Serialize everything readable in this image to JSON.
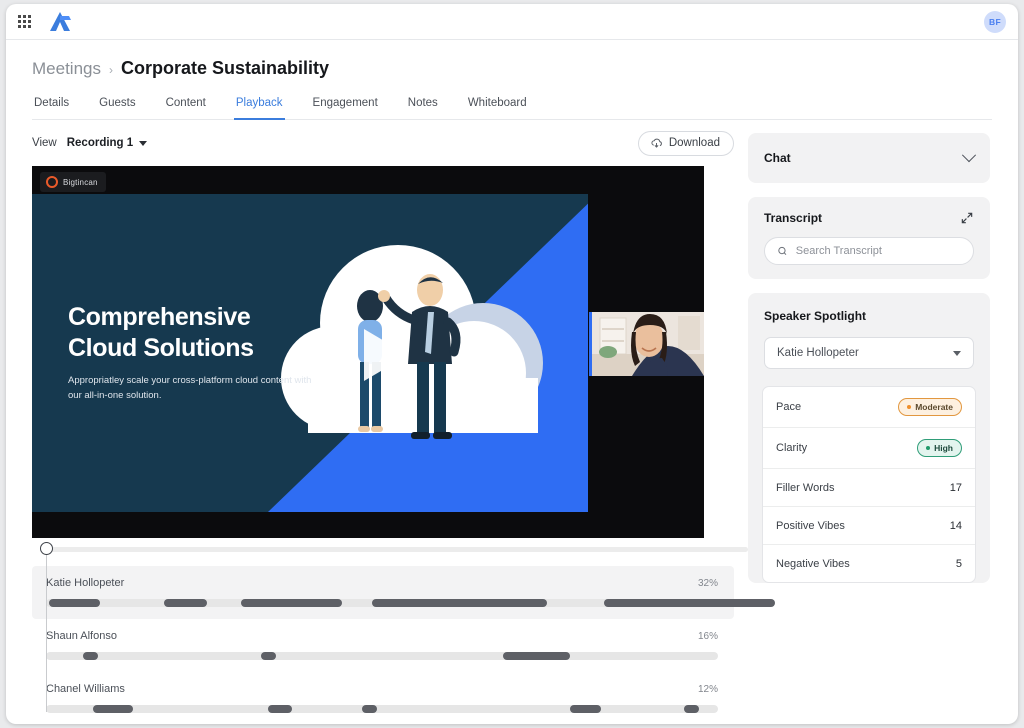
{
  "topbar": {
    "app_launcher_icon": "grid-apps-icon",
    "logo_icon": "brand-a-logo",
    "avatar_initials": "BF",
    "avatar_bg": "#cfdcfb",
    "avatar_fg": "#4a7ff0"
  },
  "breadcrumb": {
    "parent": "Meetings",
    "separator": "›",
    "current": "Corporate Sustainability"
  },
  "tabs": [
    {
      "label": "Details",
      "active": false
    },
    {
      "label": "Guests",
      "active": false
    },
    {
      "label": "Content",
      "active": false
    },
    {
      "label": "Playback",
      "active": true
    },
    {
      "label": "Engagement",
      "active": false
    },
    {
      "label": "Notes",
      "active": false
    },
    {
      "label": "Whiteboard",
      "active": false
    }
  ],
  "accent_color": "#3b7ddd",
  "toolbar": {
    "view_label": "View",
    "recording_label": "Recording 1",
    "recording_caret_icon": "caret-down-icon",
    "download_label": "Download",
    "download_icon": "cloud-download-icon"
  },
  "video": {
    "watermark_text": "Bigtincan",
    "watermark_icon": "bigtincan-ring-logo",
    "play_icon": "play-triangle-icon",
    "slide_title_line1": "Comprehensive",
    "slide_title_line2": "Cloud Solutions",
    "slide_subtitle": "Appropriatley scale your cross-platform cloud content with our all-in-one solution.",
    "slide_bg": "#16394f",
    "slide_accent": "#2f6df3",
    "camera_thumbnail_alt": "speaker-webcam"
  },
  "scrubber": {
    "handle_icon": "scrubber-handle",
    "position_percent": 0
  },
  "speakers": [
    {
      "name": "Katie Hollopeter",
      "percent": "32%",
      "highlighted": true,
      "segments": [
        {
          "start": 0.5,
          "width": 7.5
        },
        {
          "start": 17.5,
          "width": 6.5
        },
        {
          "start": 29.0,
          "width": 15.0
        },
        {
          "start": 70.0,
          "width": 2.2
        },
        {
          "start": 48.5,
          "width": 26.0
        },
        {
          "start": 83.0,
          "width": 25.5
        }
      ]
    },
    {
      "name": "Shaun Alfonso",
      "percent": "16%",
      "highlighted": false,
      "segments": [
        {
          "start": 5.5,
          "width": 2.2
        },
        {
          "start": 32.0,
          "width": 2.2
        },
        {
          "start": 68.0,
          "width": 10.0
        }
      ]
    },
    {
      "name": "Chanel Williams",
      "percent": "12%",
      "highlighted": false,
      "segments": [
        {
          "start": 7.0,
          "width": 6.0
        },
        {
          "start": 33.0,
          "width": 3.6
        },
        {
          "start": 47.0,
          "width": 2.2
        },
        {
          "start": 78.0,
          "width": 4.6
        },
        {
          "start": 95.0,
          "width": 2.2
        }
      ]
    }
  ],
  "chat_panel": {
    "title": "Chat",
    "collapse_icon": "chevron-down-icon"
  },
  "transcript_panel": {
    "title": "Transcript",
    "expand_icon": "expand-diagonal-icon",
    "search_placeholder": "Search Transcript",
    "search_value": "",
    "search_icon": "search-icon"
  },
  "spotlight_panel": {
    "title": "Speaker Spotlight",
    "selected_speaker": "Katie Hollopeter",
    "dropdown_icon": "caret-down-icon",
    "metrics": [
      {
        "label": "Pace",
        "type": "badge",
        "value": "Moderate",
        "tone": "amber"
      },
      {
        "label": "Clarity",
        "type": "badge",
        "value": "High",
        "tone": "green"
      },
      {
        "label": "Filler Words",
        "type": "number",
        "value": "17"
      },
      {
        "label": "Positive Vibes",
        "type": "number",
        "value": "14"
      },
      {
        "label": "Negative Vibes",
        "type": "number",
        "value": "5"
      }
    ]
  }
}
